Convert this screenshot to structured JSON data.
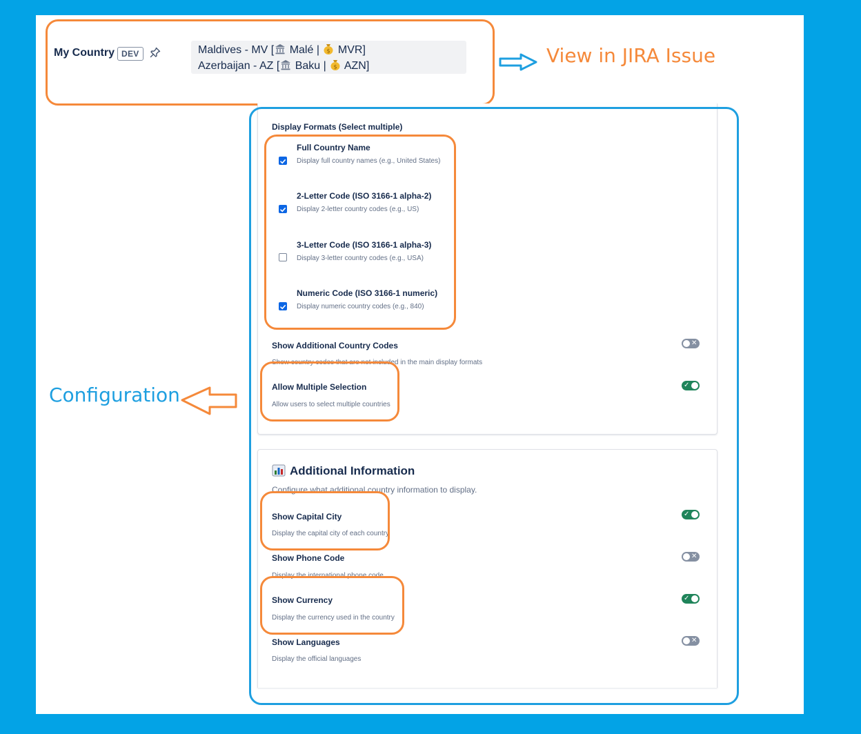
{
  "jira_view": {
    "field_label": "My Country",
    "badge": "DEV",
    "values": [
      {
        "name": "Maldives - MV [",
        "capital": "Malé",
        "sep": "|",
        "currency": "MVR]"
      },
      {
        "name": "Azerbaijan - AZ [",
        "capital": "Baku",
        "sep": "|",
        "currency": "AZN]"
      }
    ]
  },
  "annotations": {
    "view_label": "View in JIRA Issue",
    "config_label": "Configuration",
    "orange": "#f5893a",
    "blue": "#1e9fe0"
  },
  "display_formats": {
    "heading": "Display Formats (Select multiple)",
    "options": [
      {
        "title": "Full Country Name",
        "desc": "Display full country names (e.g., United States)",
        "checked": true
      },
      {
        "title": "2-Letter Code (ISO 3166-1 alpha-2)",
        "desc": "Display 2-letter country codes (e.g., US)",
        "checked": true
      },
      {
        "title": "3-Letter Code (ISO 3166-1 alpha-3)",
        "desc": "Display 3-letter country codes (e.g., USA)",
        "checked": false
      },
      {
        "title": "Numeric Code (ISO 3166-1 numeric)",
        "desc": "Display numeric country codes (e.g., 840)",
        "checked": true
      }
    ]
  },
  "settings": [
    {
      "title": "Show Additional Country Codes",
      "desc": "Show country codes that are not included in the main display formats",
      "on": false
    },
    {
      "title": "Allow Multiple Selection",
      "desc": "Allow users to select multiple countries",
      "on": true
    }
  ],
  "additional_info": {
    "title": "Additional Information",
    "subtitle": "Configure what additional country information to display.",
    "items": [
      {
        "title": "Show Capital City",
        "desc": "Display the capital city of each country",
        "on": true
      },
      {
        "title": "Show Phone Code",
        "desc": "Display the international phone code",
        "on": false
      },
      {
        "title": "Show Currency",
        "desc": "Display the currency used in the country",
        "on": true
      },
      {
        "title": "Show Languages",
        "desc": "Display the official languages",
        "on": false
      }
    ]
  },
  "colors": {
    "checkbox": "#0c66e4",
    "toggle_on": "#1f845a",
    "toggle_off": "#8590a2",
    "background": "#03a3e6"
  },
  "icons": [
    "pin-icon",
    "bank-icon",
    "money-bag-icon",
    "checkmark-icon",
    "cross-icon",
    "bar-chart-icon",
    "arrow-right-icon",
    "arrow-left-icon"
  ]
}
